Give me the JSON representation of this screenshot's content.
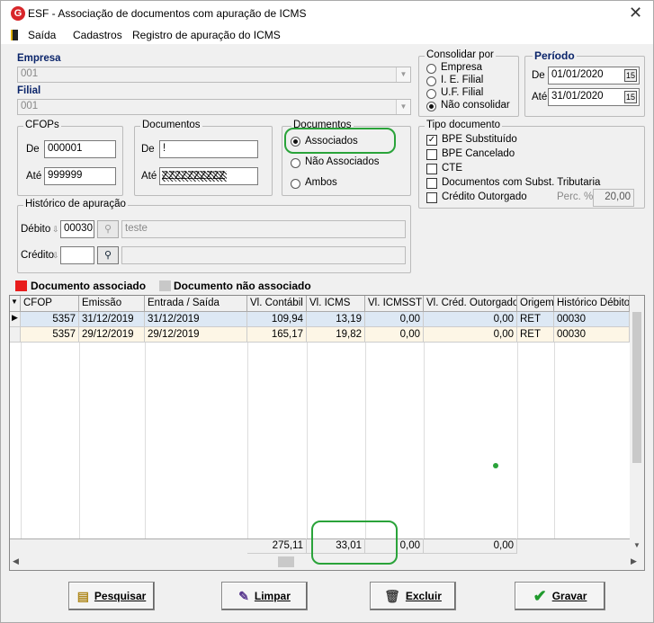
{
  "window": {
    "title": "ESF - Associação de documentos com apuração de ICMS",
    "close": "✕"
  },
  "menu": [
    "Saída",
    "Cadastros",
    "Registro de apuração do ICMS"
  ],
  "empresa": {
    "label": "Empresa",
    "value": "001"
  },
  "filial": {
    "label": "Filial",
    "value": "001"
  },
  "consolidar": {
    "title": "Consolidar por",
    "options": [
      "Empresa",
      "I. E. Filial",
      "U.F. Filial",
      "Não consolidar"
    ],
    "selected": "Não consolidar"
  },
  "periodo": {
    "title": "Período",
    "de_label": "De",
    "de": "01/01/2020",
    "ate_label": "Até",
    "ate": "31/01/2020",
    "cal": "15"
  },
  "cfops": {
    "title": "CFOPs",
    "de_label": "De",
    "de": "000001",
    "ate_label": "Até",
    "ate": "999999"
  },
  "documentos_range": {
    "title": "Documentos",
    "de_label": "De",
    "de": "!",
    "ate_label": "Até",
    "ate": "ZZZZZZZZZZ"
  },
  "documentos_filter": {
    "title": "Documentos",
    "options": [
      "Associados",
      "Não Associados",
      "Ambos"
    ],
    "selected": "Associados"
  },
  "tipo_documento": {
    "title": "Tipo documento",
    "items": [
      {
        "label": "BPE Substituído",
        "checked": true
      },
      {
        "label": "BPE Cancelado",
        "checked": false
      },
      {
        "label": "CTE",
        "checked": false
      },
      {
        "label": "Documentos com Subst. Tributaria",
        "checked": false
      },
      {
        "label": "Crédito Outorgado",
        "checked": false
      }
    ],
    "perc_label": "Perc. %",
    "perc_value": "20,00"
  },
  "historico": {
    "title": "Histórico de apuração",
    "debito_label": "Débito",
    "debito_code": "00030",
    "debito_desc": "teste",
    "credito_label": "Crédito",
    "credito_code": "",
    "credito_desc": ""
  },
  "legend": {
    "associado": "Documento associado",
    "nao_associado": "Documento não associado",
    "associado_color": "#e81c1c",
    "nao_associado_color": "#c8c8c8"
  },
  "grid": {
    "columns": [
      "CFOP",
      "Emissão",
      "Entrada / Saída",
      "Vl. Contábil",
      "Vl. ICMS",
      "Vl. ICMSST",
      "Vl. Créd. Outorgado",
      "Origem",
      "Histórico Débito"
    ],
    "rows": [
      [
        "5357",
        "31/12/2019",
        "31/12/2019",
        "109,94",
        "13,19",
        "0,00",
        "0,00",
        "RET",
        "00030"
      ],
      [
        "5357",
        "29/12/2019",
        "29/12/2019",
        "165,17",
        "19,82",
        "0,00",
        "0,00",
        "RET",
        "00030"
      ]
    ],
    "totals": {
      "contabil": "275,11",
      "icms": "33,01",
      "icmsst": "0,00",
      "outorgado": "0,00"
    }
  },
  "buttons": {
    "pesquisar": "Pesquisar",
    "limpar": "Limpar",
    "excluir": "Excluir",
    "gravar": "Gravar"
  }
}
